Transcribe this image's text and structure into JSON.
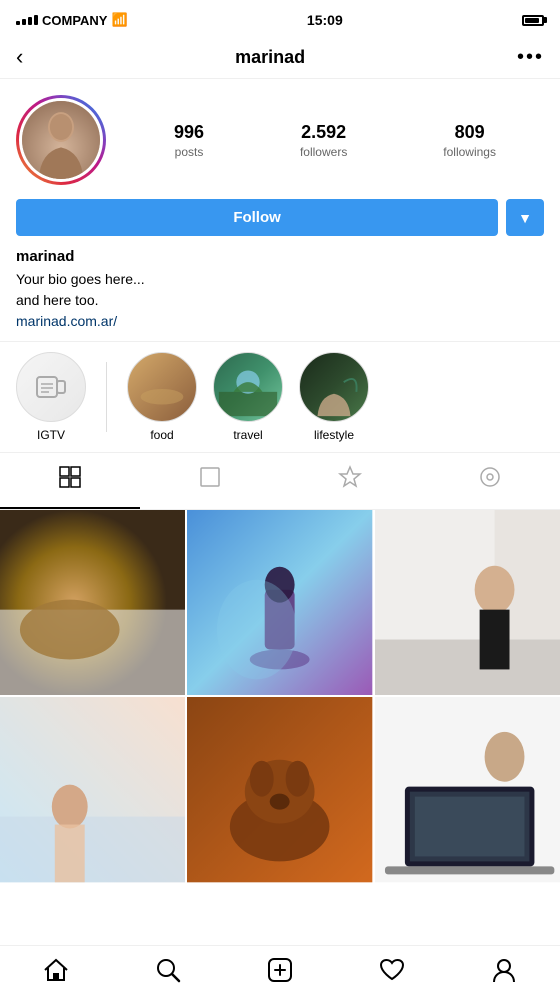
{
  "statusBar": {
    "carrier": "COMPANY",
    "time": "15:09"
  },
  "header": {
    "username": "marinad",
    "backLabel": "‹",
    "moreLabel": "•••"
  },
  "profile": {
    "stats": {
      "posts": {
        "count": "996",
        "label": "posts"
      },
      "followers": {
        "count": "2.592",
        "label": "followers"
      },
      "following": {
        "count": "809",
        "label": "followings"
      }
    },
    "followButton": "Follow",
    "dropdownLabel": "▼",
    "name": "marinad",
    "bio": "Your bio goes here...\nand here too.",
    "website": "marinad.com.ar/"
  },
  "highlights": [
    {
      "id": "igtv",
      "label": "IGTV",
      "type": "igtv"
    },
    {
      "id": "food",
      "label": "food",
      "type": "food"
    },
    {
      "id": "travel",
      "label": "travel",
      "type": "travel"
    },
    {
      "id": "lifestyle",
      "label": "lifestyle",
      "type": "lifestyle"
    }
  ],
  "tabs": [
    {
      "id": "grid",
      "label": "grid",
      "icon": "⊞",
      "active": true
    },
    {
      "id": "tagged",
      "label": "tagged",
      "icon": "☐",
      "active": false
    },
    {
      "id": "saved",
      "label": "saved",
      "icon": "✩",
      "active": false
    },
    {
      "id": "igtv",
      "label": "igtv",
      "icon": "⊙",
      "active": false
    }
  ],
  "bottomNav": [
    {
      "id": "home",
      "icon": "⌂"
    },
    {
      "id": "search",
      "icon": "⌕"
    },
    {
      "id": "add",
      "icon": "⊕"
    },
    {
      "id": "heart",
      "icon": "♡"
    },
    {
      "id": "profile",
      "icon": "◉"
    }
  ],
  "photos": [
    {
      "id": 1,
      "colors": [
        "#a0704a",
        "#c8923a",
        "#fff5e0",
        "#dfd3c0"
      ]
    },
    {
      "id": 2,
      "colors": [
        "#3a7bd5",
        "#87ceeb",
        "#b3d9f5",
        "#9b59b6"
      ]
    },
    {
      "id": 3,
      "colors": [
        "#f0eeec",
        "#d8cfc8",
        "#b0a89e",
        "#8a8078"
      ]
    },
    {
      "id": 4,
      "colors": [
        "#f2d3b8",
        "#e8b89a",
        "#d4a07c",
        "#c89068"
      ]
    },
    {
      "id": 5,
      "colors": [
        "#8B4513",
        "#a0522d",
        "#c46a2a",
        "#d2691e"
      ]
    },
    {
      "id": 6,
      "colors": [
        "#1a1a2e",
        "#2d3748",
        "#4a5568",
        "#718096"
      ]
    }
  ]
}
